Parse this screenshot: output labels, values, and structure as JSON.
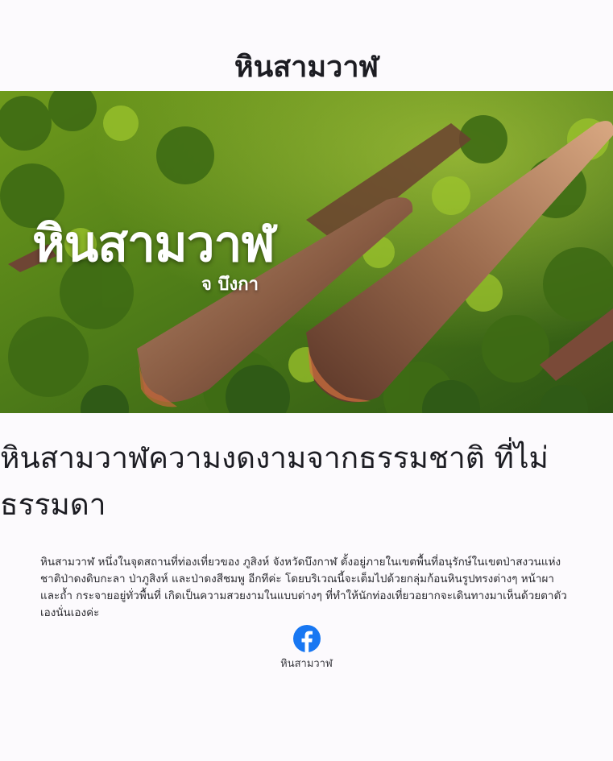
{
  "header": {
    "site_title": "หินสามวาฬ"
  },
  "hero": {
    "title": "หินสามวาฬ",
    "subtitle": "จ บึงกา"
  },
  "article": {
    "heading": "หินสามวาฬความงดงามจากธรรมชาติ ที่ไม่ธรรมดา",
    "body": "หินสามวาฬ หนึ่งในจุดสถานที่ท่องเที่ยวของ ภูสิงห์ จังหวัดบึงกาฬ ตั้งอยู่ภายในเขตพื้นที่อนุรักษ์ในเขตป่าสงวนแห่งชาติป่าดงดิบกะลา ป่าภูสิงห์ และป่าดงสีชมพู อีกทีค่ะ โดยบริเวณนี้จะเต็มไปด้วยกลุ่มก้อนหินรูปทรงต่างๆ หน้าผา และถ้ำ กระจายอยู่ทั่วพื้นที่ เกิดเป็นความสวยงามในแบบต่างๆ ที่ทำให้นักท่องเที่ยวอยากจะเดินทางมาเห็นด้วยตาตัวเองนั่นเองค่ะ"
  },
  "social": {
    "icon": "facebook-icon",
    "label": "หินสามวาฬ",
    "color": "#1877f2"
  },
  "colors": {
    "background": "#fcfafd",
    "forest_dark": "#2f5a16",
    "forest_light": "#8fbf2a",
    "rock": "#7a4e3a"
  }
}
